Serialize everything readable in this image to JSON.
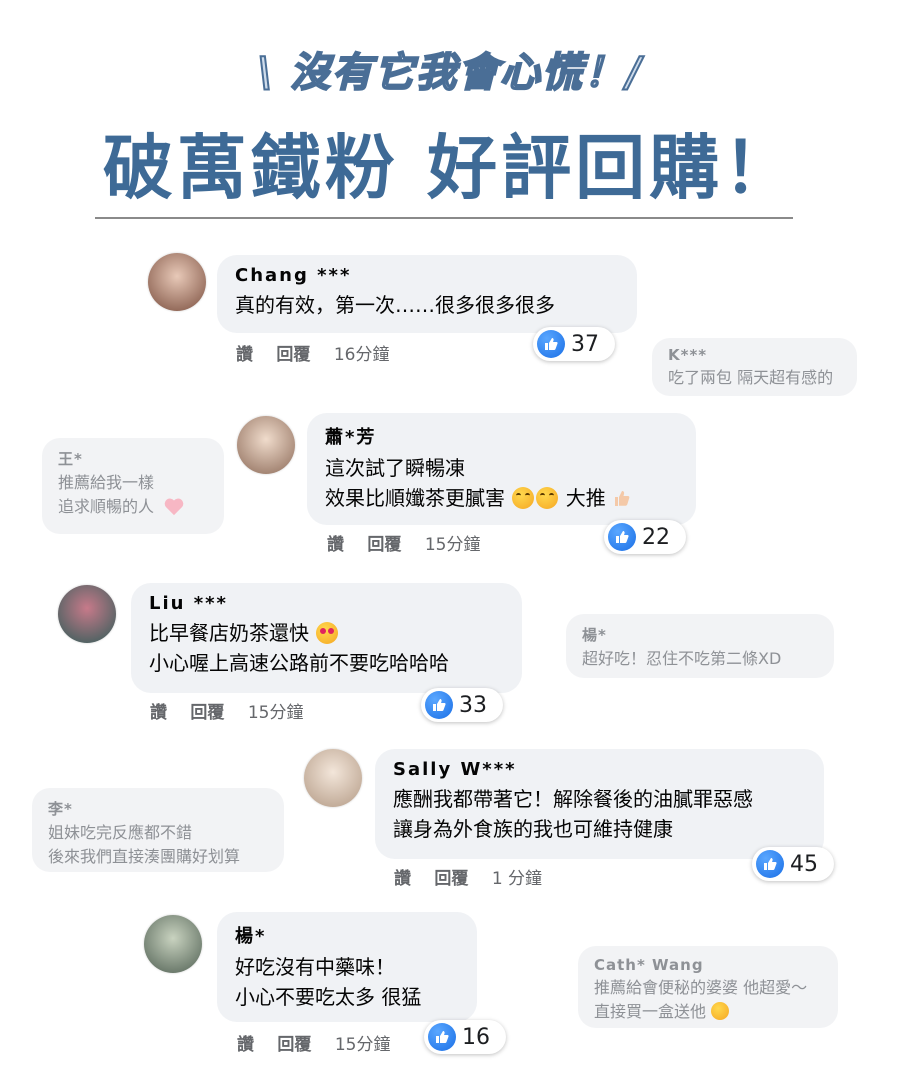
{
  "header": {
    "subtitle": "\\ 沒有它我會心慌！/",
    "headline": "破萬鐵粉 好評回購！"
  },
  "comments": [
    {
      "name": "Chang ***",
      "lines": [
        "真的有效，第一次……很多很多很多"
      ],
      "meta": {
        "like": "讚",
        "reply": "回覆",
        "time": "16分鐘"
      },
      "likes": "37",
      "avatar_color": "#8a5a4a"
    },
    {
      "name": "蕭*芳",
      "lines": [
        "這次試了瞬暢凍",
        "效果比順孅茶更膩害",
        "大推"
      ],
      "meta": {
        "like": "讚",
        "reply": "回覆",
        "time": "15分鐘"
      },
      "likes": "22",
      "avatar_color": "#9a7a6a"
    },
    {
      "name": "Liu ***",
      "lines": [
        "比早餐店奶茶還快",
        "小心喔上高速公路前不要吃哈哈哈"
      ],
      "meta": {
        "like": "讚",
        "reply": "回覆",
        "time": "15分鐘"
      },
      "likes": "33",
      "avatar_color": "#3d6e6a"
    },
    {
      "name": "Sally W***",
      "lines": [
        "應酬我都帶著它！解除餐後的油膩罪惡感",
        "讓身為外食族的我也可維持健康"
      ],
      "meta": {
        "like": "讚",
        "reply": "回覆",
        "time": "1 分鐘"
      },
      "likes": "45",
      "avatar_color": "#c8b6a6"
    },
    {
      "name": "楊*",
      "lines": [
        "好吃沒有中藥味！",
        "小心不要吃太多 很猛"
      ],
      "meta": {
        "like": "讚",
        "reply": "回覆",
        "time": "15分鐘"
      },
      "likes": "16",
      "avatar_color": "#6a7a6a"
    }
  ],
  "faint_comments": [
    {
      "name": "K***",
      "lines": [
        "吃了兩包 隔天超有感的"
      ]
    },
    {
      "name": "王*",
      "lines": [
        "推薦給我一樣",
        "追求順暢的人"
      ]
    },
    {
      "name": "楊*",
      "lines": [
        "超好吃！忍住不吃第二條XD"
      ]
    },
    {
      "name": "李*",
      "lines": [
        "姐妹吃完反應都不錯",
        "後來我們直接湊團購好划算"
      ]
    },
    {
      "name": "Cath* Wang",
      "lines": [
        "推薦給會便秘的婆婆 他超愛～",
        "直接買一盒送他"
      ]
    }
  ],
  "colors": {
    "headline": "#3e6a96",
    "like_blue": "#1a6fe6",
    "bubble_bg": "#f0f2f5"
  }
}
